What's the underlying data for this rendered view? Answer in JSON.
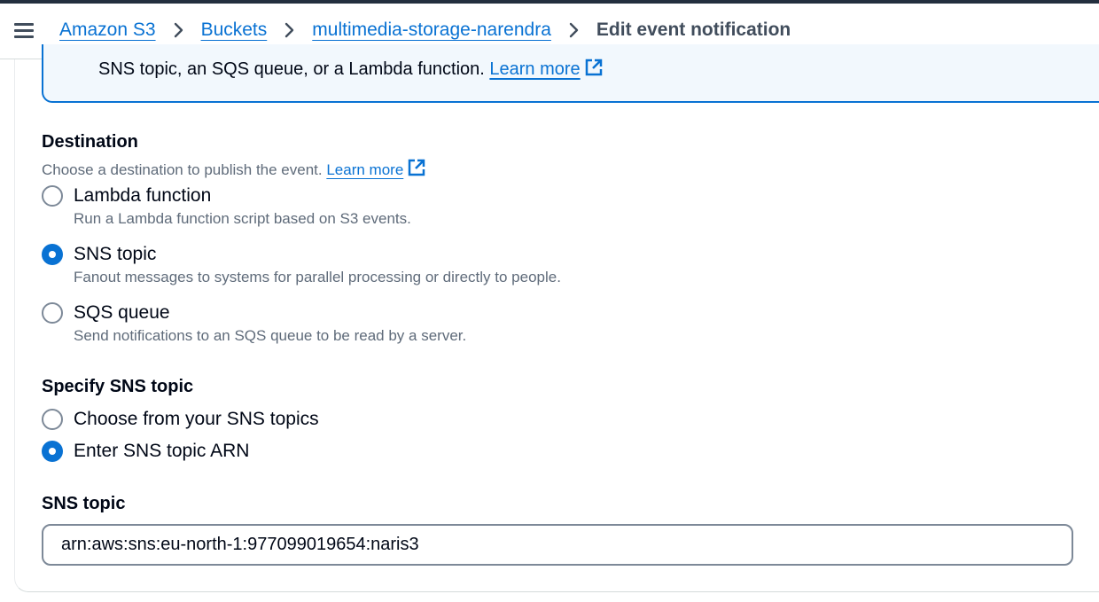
{
  "breadcrumb": {
    "items": [
      "Amazon S3",
      "Buckets",
      "multimedia-storage-narendra"
    ],
    "current": "Edit event notification"
  },
  "info": {
    "text": "SNS topic, an SQS queue, or a Lambda function.",
    "link": "Learn more"
  },
  "destination": {
    "title": "Destination",
    "description": "Choose a destination to publish the event.",
    "link": "Learn more",
    "options": [
      {
        "label": "Lambda function",
        "desc": "Run a Lambda function script based on S3 events.",
        "checked": false
      },
      {
        "label": "SNS topic",
        "desc": "Fanout messages to systems for parallel processing or directly to people.",
        "checked": true
      },
      {
        "label": "SQS queue",
        "desc": "Send notifications to an SQS queue to be read by a server.",
        "checked": false
      }
    ]
  },
  "specify_sns": {
    "title": "Specify SNS topic",
    "options": [
      {
        "label": "Choose from your SNS topics",
        "checked": false
      },
      {
        "label": "Enter SNS topic ARN",
        "checked": true
      }
    ]
  },
  "sns_topic": {
    "label": "SNS topic",
    "value": "arn:aws:sns:eu-north-1:977099019654:naris3"
  },
  "colors": {
    "accent": "#0972d3",
    "header_dark": "#232f3e",
    "info_bg": "#f2f8fd"
  }
}
